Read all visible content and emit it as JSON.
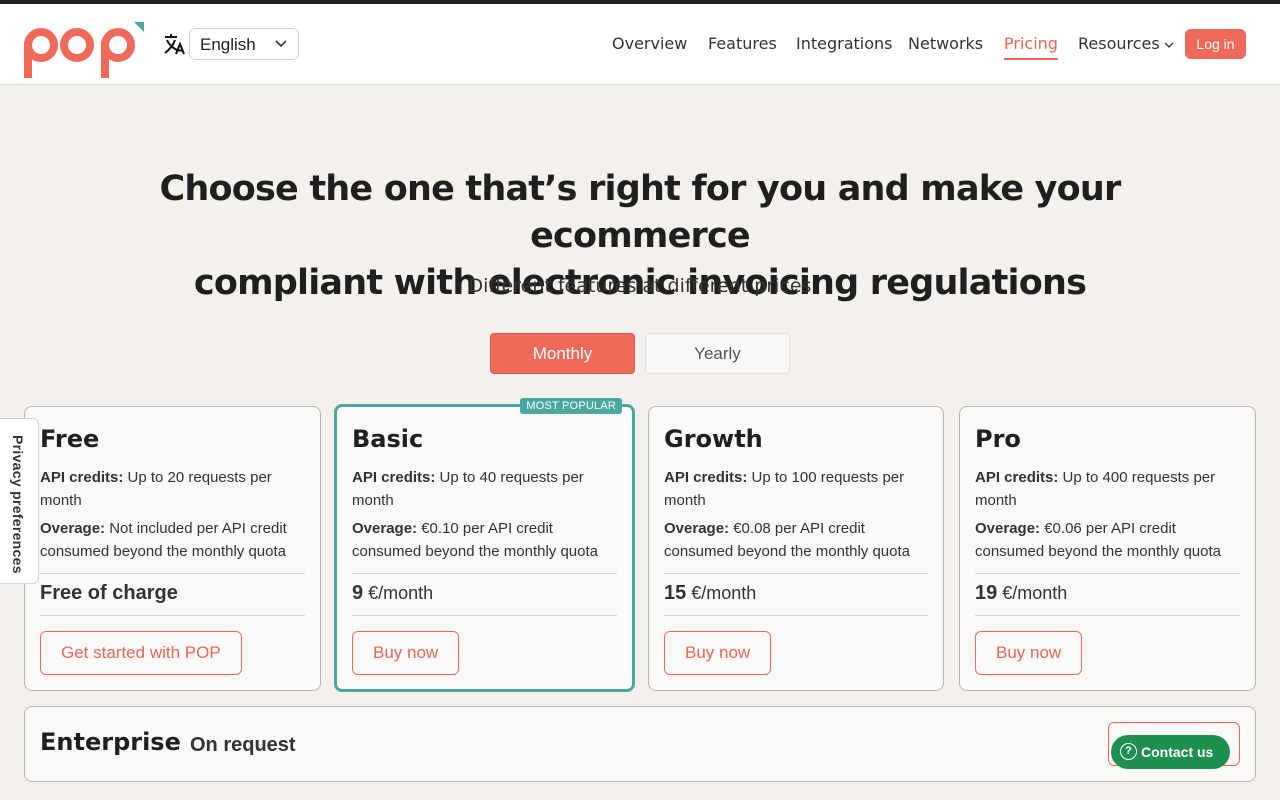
{
  "brand": {
    "logo_text": "pop",
    "accent_color": "#f06a5c",
    "popular_color": "#4aa8a0"
  },
  "language": {
    "selected": "English"
  },
  "nav": {
    "items": [
      {
        "label": "Overview"
      },
      {
        "label": "Features"
      },
      {
        "label": "Integrations"
      },
      {
        "label": "Networks"
      },
      {
        "label": "Pricing",
        "active": true
      },
      {
        "label": "Resources"
      }
    ],
    "login_label": "Log in"
  },
  "hero": {
    "title_line1": "Choose the one that’s right for you and make your ecommerce",
    "title_line2": "compliant with electronic invoicing regulations",
    "subtitle": "Different features at different prices"
  },
  "billing_toggle": {
    "monthly": "Monthly",
    "yearly": "Yearly",
    "selected": "Monthly"
  },
  "plans": [
    {
      "name": "Free",
      "credits_label": "API credits:",
      "credits_value": "Up to 20 requests per month",
      "overage_label": "Overage:",
      "overage_value": "Not included per API credit consumed beyond the monthly quota",
      "price_text": "Free of charge",
      "cta": "Get started with POP"
    },
    {
      "name": "Basic",
      "badge": "MOST POPULAR",
      "credits_label": "API credits:",
      "credits_value": "Up to 40 requests per month",
      "overage_label": "Overage:",
      "overage_value": "€0.10 per API credit consumed beyond the monthly quota",
      "price_amount": "9",
      "price_unit": "€/month",
      "cta": "Buy now"
    },
    {
      "name": "Growth",
      "credits_label": "API credits:",
      "credits_value": "Up to 100 requests per month",
      "overage_label": "Overage:",
      "overage_value": "€0.08 per API credit consumed beyond the monthly quota",
      "price_amount": "15",
      "price_unit": "€/month",
      "cta": "Buy now"
    },
    {
      "name": "Pro",
      "credits_label": "API credits:",
      "credits_value": "Up to 400 requests per month",
      "overage_label": "Overage:",
      "overage_value": "€0.06 per API credit consumed beyond the monthly quota",
      "price_amount": "19",
      "price_unit": "€/month",
      "cta": "Buy now"
    }
  ],
  "enterprise": {
    "name": "Enterprise",
    "price_text": "On request"
  },
  "widgets": {
    "contact_label": "Contact us",
    "privacy_label": "Privacy preferences"
  }
}
